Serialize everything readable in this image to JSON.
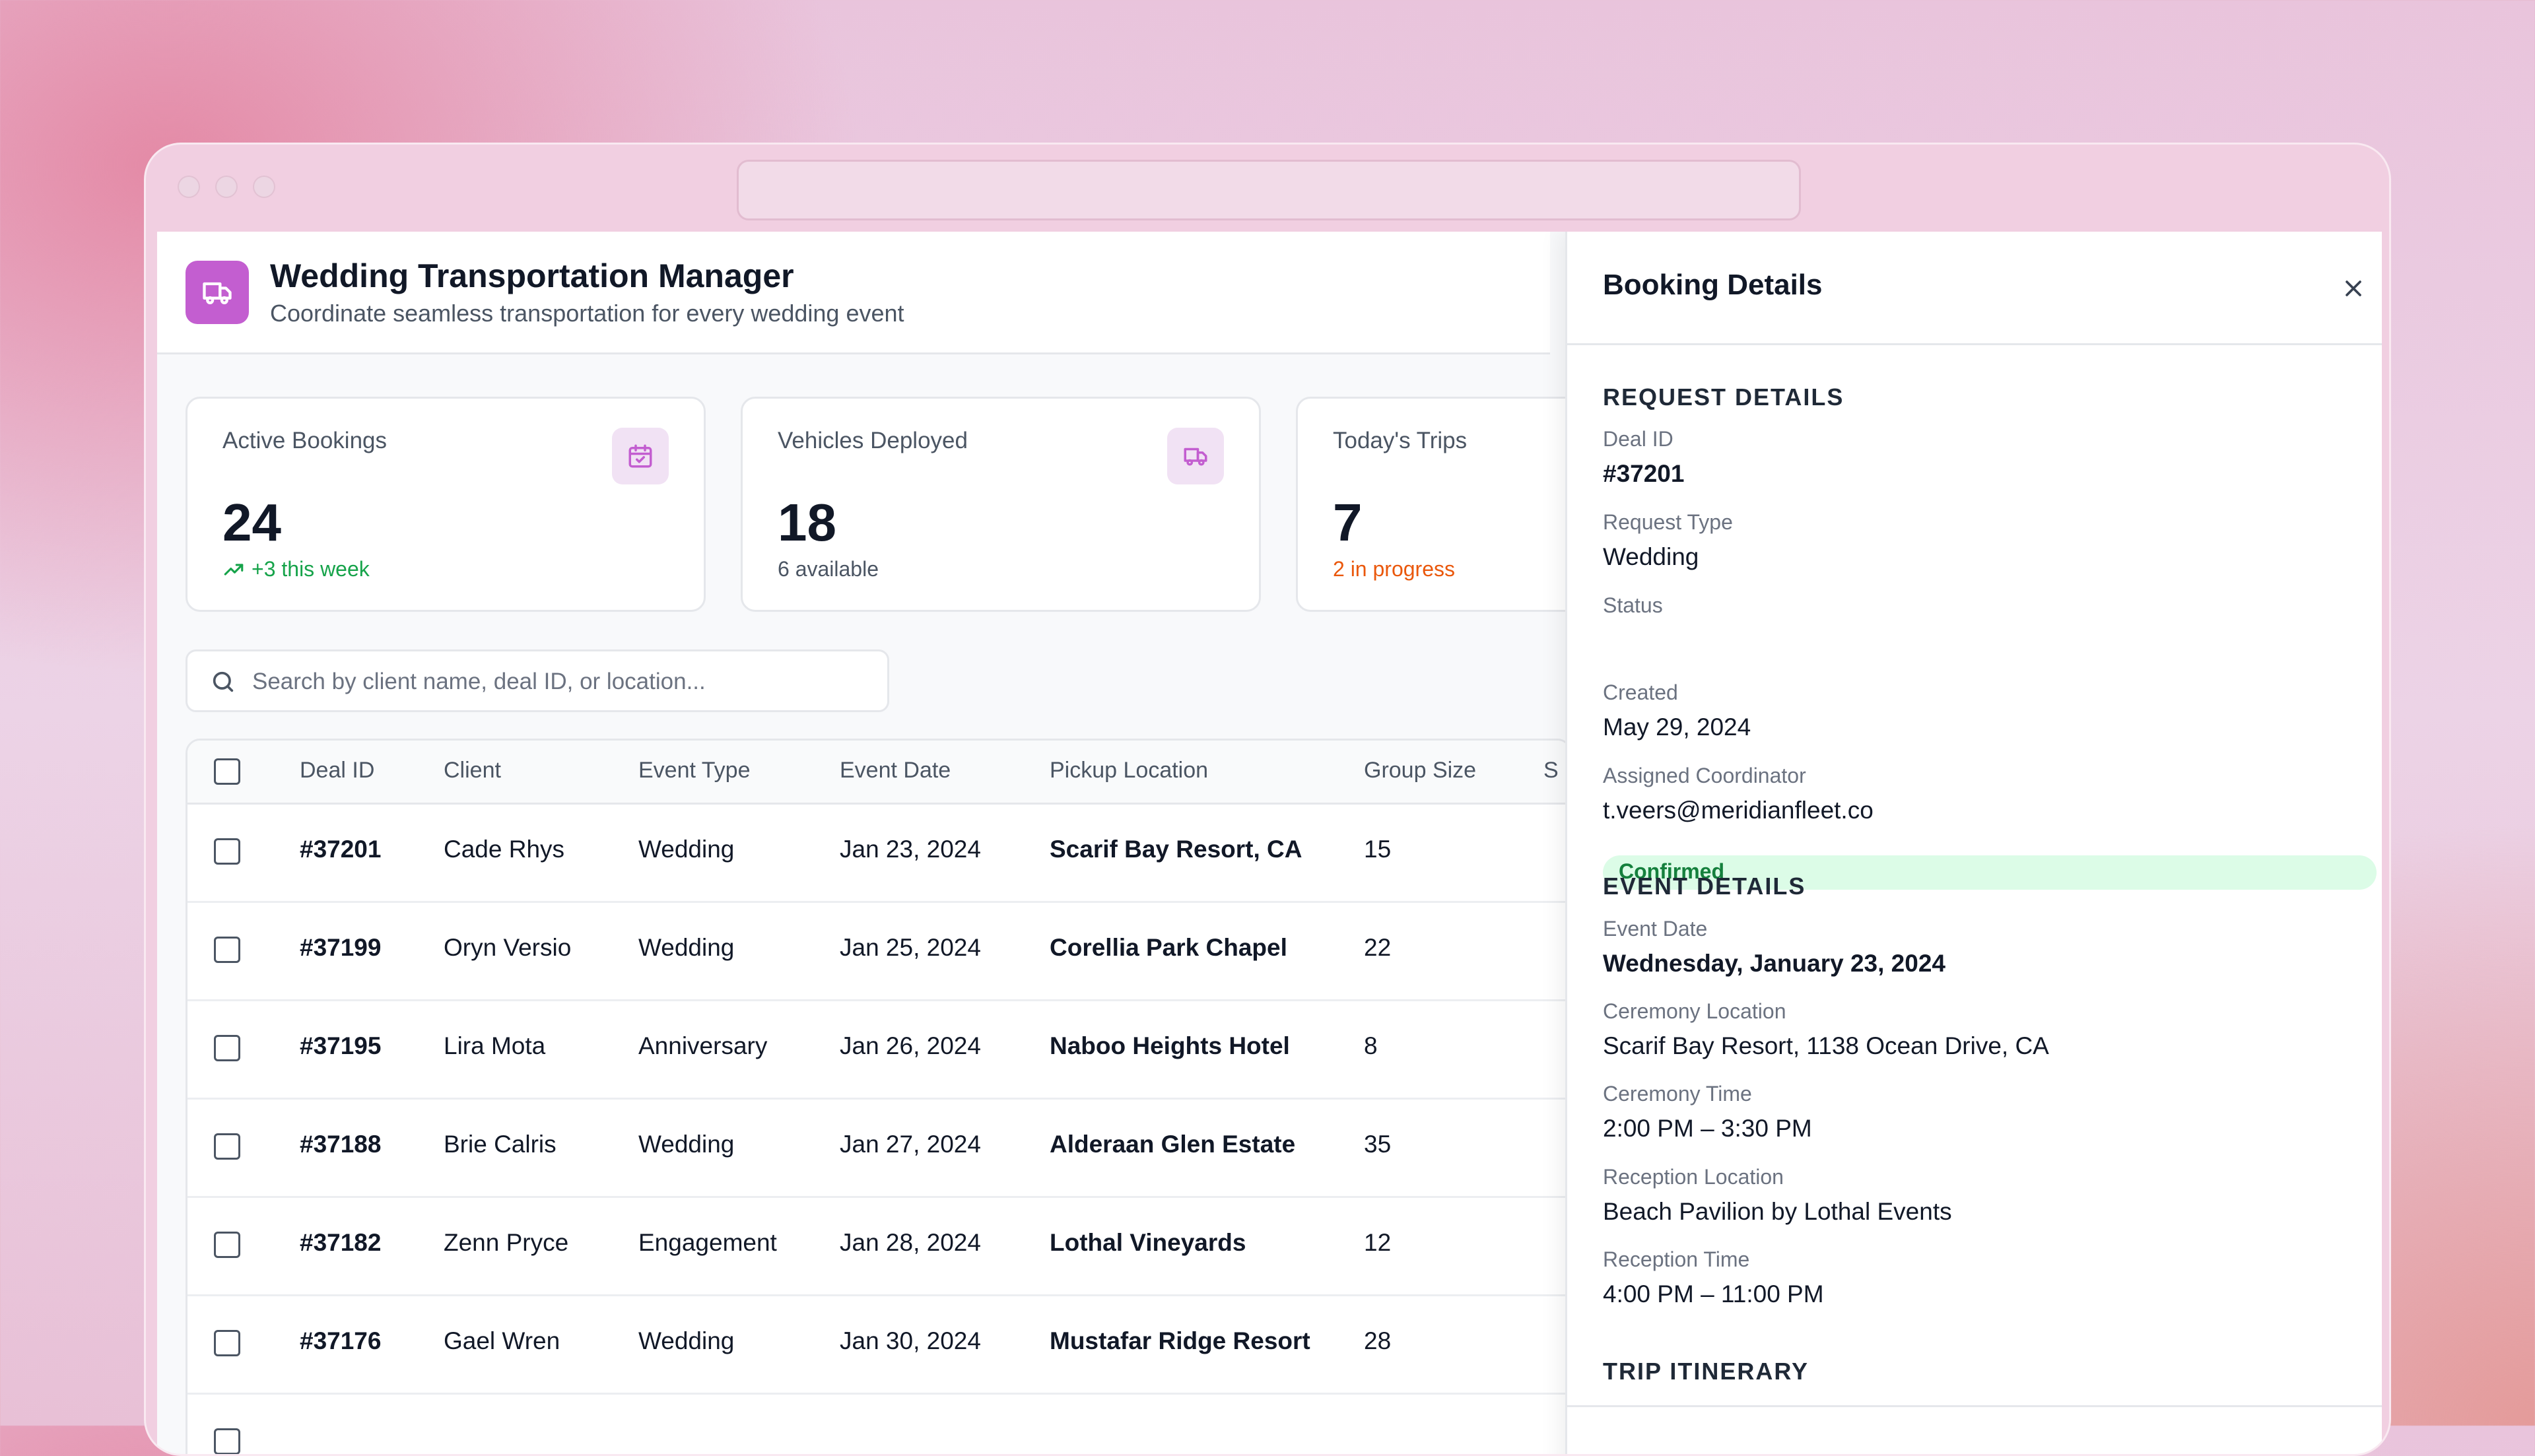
{
  "app": {
    "title": "Wedding Transportation Manager",
    "subtitle": "Coordinate seamless transportation for every wedding event",
    "accent": "#c35ed0"
  },
  "stats": [
    {
      "label": "Active Bookings",
      "value": "24",
      "sub": "+3 this week",
      "sub_color": "#16a34a",
      "icon": "calendar-check-icon"
    },
    {
      "label": "Vehicles Deployed",
      "value": "18",
      "sub": "6 available",
      "sub_color": "#4b5563",
      "icon": "truck-icon"
    },
    {
      "label": "Today's Trips",
      "value": "7",
      "sub": "2 in progress",
      "sub_color": "#ea580c"
    }
  ],
  "search": {
    "placeholder": "Search by client name, deal ID, or location..."
  },
  "table": {
    "columns": [
      "Deal ID",
      "Client",
      "Event Type",
      "Event Date",
      "Pickup Location",
      "Group Size",
      "S"
    ],
    "rows": [
      {
        "id": "#37201",
        "client": "Cade Rhys",
        "type": "Wedding",
        "date": "Jan 23, 2024",
        "pickup": "Scarif Bay Resort, CA",
        "size": "15"
      },
      {
        "id": "#37199",
        "client": "Oryn Versio",
        "type": "Wedding",
        "date": "Jan 25, 2024",
        "pickup": "Corellia Park Chapel",
        "size": "22"
      },
      {
        "id": "#37195",
        "client": "Lira Mota",
        "type": "Anniversary",
        "date": "Jan 26, 2024",
        "pickup": "Naboo Heights Hotel",
        "size": "8"
      },
      {
        "id": "#37188",
        "client": "Brie Calris",
        "type": "Wedding",
        "date": "Jan 27, 2024",
        "pickup": "Alderaan Glen Estate",
        "size": "35"
      },
      {
        "id": "#37182",
        "client": "Zenn Pryce",
        "type": "Engagement",
        "date": "Jan 28, 2024",
        "pickup": "Lothal Vineyards",
        "size": "12"
      },
      {
        "id": "#37176",
        "client": "Gael Wren",
        "type": "Wedding",
        "date": "Jan 30, 2024",
        "pickup": "Mustafar Ridge Resort",
        "size": "28"
      }
    ]
  },
  "panel": {
    "title": "Booking Details",
    "request_section": "REQUEST DETAILS",
    "deal_id_label": "Deal ID",
    "deal_id": "#37201",
    "request_type_label": "Request Type",
    "request_type": "Wedding",
    "status_label": "Status",
    "status": "Confirmed",
    "created_label": "Created",
    "created": "May 29, 2024",
    "coordinator_label": "Assigned Coordinator",
    "coordinator": "t.veers@meridianfleet.co",
    "event_section": "EVENT DETAILS",
    "event_date_label": "Event Date",
    "event_date": "Wednesday, January 23, 2024",
    "ceremony_location_label": "Ceremony Location",
    "ceremony_location": "Scarif Bay Resort, 1138 Ocean Drive, CA",
    "ceremony_time_label": "Ceremony Time",
    "ceremony_time": "2:00 PM – 3:30 PM",
    "reception_location_label": "Reception Location",
    "reception_location": "Beach Pavilion by Lothal Events",
    "reception_time_label": "Reception Time",
    "reception_time": "4:00 PM – 11:00 PM",
    "itinerary_section": "TRIP ITINERARY"
  }
}
